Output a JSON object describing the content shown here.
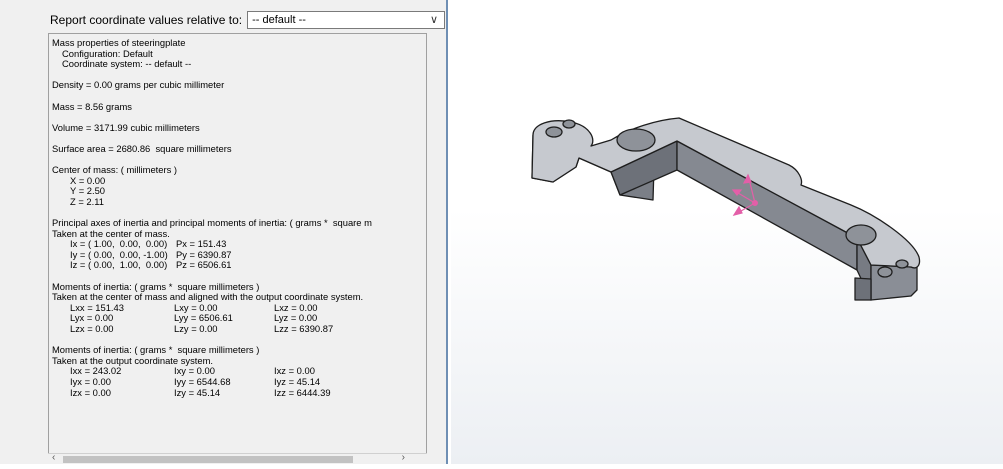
{
  "report": {
    "label": "Report coordinate values relative to:",
    "selected": "-- default --"
  },
  "results": {
    "title": "Mass properties of steeringplate",
    "configuration": "Configuration: Default",
    "coordinate_system": "Coordinate system: -- default --",
    "density": "Density = 0.00 grams per cubic millimeter",
    "mass": "Mass = 8.56 grams",
    "volume": "Volume = 3171.99 cubic millimeters",
    "surface_area": "Surface area = 2680.86  square millimeters",
    "center_of_mass": {
      "heading": "Center of mass: ( millimeters )",
      "x": "X = 0.00",
      "y": "Y = 2.50",
      "z": "Z = 2.11"
    },
    "principal": {
      "heading": "Principal axes of inertia and principal moments of inertia: ( grams *  square m",
      "subheading": "Taken at the center of mass.",
      "rows": [
        {
          "axis": "Ix = ( 1.00,  0.00,  0.00)",
          "moment": "Px = 151.43"
        },
        {
          "axis": "Iy = ( 0.00,  0.00, -1.00)",
          "moment": "Py = 6390.87"
        },
        {
          "axis": "Iz = ( 0.00,  1.00,  0.00)",
          "moment": "Pz = 6506.61"
        }
      ]
    },
    "moments_com": {
      "heading": "Moments of inertia: ( grams *  square millimeters )",
      "subheading": "Taken at the center of mass and aligned with the output coordinate system.",
      "rows": [
        [
          "Lxx = 151.43",
          "Lxy = 0.00",
          "Lxz = 0.00"
        ],
        [
          "Lyx = 0.00",
          "Lyy = 6506.61",
          "Lyz = 0.00"
        ],
        [
          "Lzx = 0.00",
          "Lzy = 0.00",
          "Lzz = 6390.87"
        ]
      ]
    },
    "moments_output": {
      "heading": "Moments of inertia: ( grams *  square millimeters )",
      "subheading": "Taken at the output coordinate system.",
      "rows": [
        [
          "Ixx = 243.02",
          "Ixy = 0.00",
          "Ixz = 0.00"
        ],
        [
          "Iyx = 0.00",
          "Iyy = 6544.68",
          "Iyz = 45.14"
        ],
        [
          "Izx = 0.00",
          "Izy = 45.14",
          "Izz = 6444.39"
        ]
      ]
    }
  },
  "colors": {
    "part_top": "#c6c9cf",
    "part_side": "#7b7f87",
    "part_edge": "#1e1e1e",
    "triad": "#e35fa8",
    "divider": "#6f8fb4"
  }
}
